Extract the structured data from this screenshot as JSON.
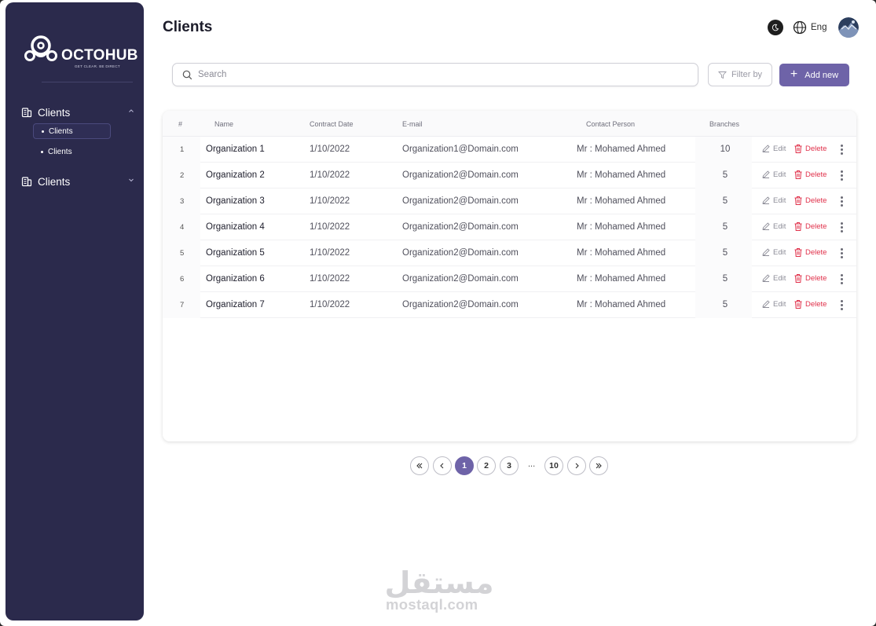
{
  "sidebar": {
    "logo_text": "OCTOHUB",
    "logo_tagline": "GET CLEAR. BE DIRECT",
    "groups": [
      {
        "label": "Clients",
        "expanded": true,
        "items": [
          {
            "label": "Clients",
            "active": true
          },
          {
            "label": "Clients",
            "active": false
          }
        ]
      },
      {
        "label": "Clients",
        "expanded": false,
        "items": []
      }
    ]
  },
  "header": {
    "title": "Clients",
    "theme_icon": "moon-icon",
    "language": "Eng",
    "language_icon": "globe-icon"
  },
  "toolbar": {
    "search_placeholder": "Search",
    "search_value": "",
    "filter_label": "Filter by",
    "add_label": "Add new"
  },
  "table": {
    "columns": [
      "#",
      "Name",
      "Contract Date",
      "E-mail",
      "Contact Person",
      "Branches"
    ],
    "rows": [
      {
        "idx": "1",
        "name": "Organization 1",
        "date": "1/10/2022",
        "email": "Organization1@Domain.com",
        "contact": "Mr : Mohamed Ahmed",
        "branches": "10"
      },
      {
        "idx": "2",
        "name": "Organization 2",
        "date": "1/10/2022",
        "email": "Organization2@Domain.com",
        "contact": "Mr : Mohamed Ahmed",
        "branches": "5"
      },
      {
        "idx": "3",
        "name": "Organization 3",
        "date": "1/10/2022",
        "email": "Organization2@Domain.com",
        "contact": "Mr : Mohamed Ahmed",
        "branches": "5"
      },
      {
        "idx": "4",
        "name": "Organization 4",
        "date": "1/10/2022",
        "email": "Organization2@Domain.com",
        "contact": "Mr : Mohamed Ahmed",
        "branches": "5"
      },
      {
        "idx": "5",
        "name": "Organization 5",
        "date": "1/10/2022",
        "email": "Organization2@Domain.com",
        "contact": "Mr : Mohamed Ahmed",
        "branches": "5"
      },
      {
        "idx": "6",
        "name": "Organization 6",
        "date": "1/10/2022",
        "email": "Organization2@Domain.com",
        "contact": "Mr : Mohamed Ahmed",
        "branches": "5"
      },
      {
        "idx": "7",
        "name": "Organization 7",
        "date": "1/10/2022",
        "email": "Organization2@Domain.com",
        "contact": "Mr : Mohamed Ahmed",
        "branches": "5"
      }
    ],
    "edit_label": "Edit",
    "delete_label": "Delete"
  },
  "pagination": {
    "pages": [
      "1",
      "2",
      "3"
    ],
    "ellipsis": "...",
    "last_page": "10",
    "current": "1"
  },
  "watermark": {
    "arabic": "مستقل",
    "latin": "mostaql.com"
  },
  "colors": {
    "sidebar_bg": "#2b2a4c",
    "accent": "#6e63a8",
    "danger": "#e0304a"
  }
}
